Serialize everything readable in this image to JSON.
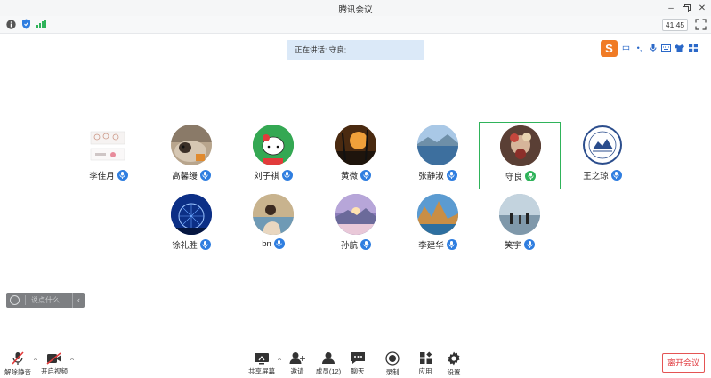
{
  "window": {
    "title": "腾讯会议"
  },
  "status": {
    "timer": "41:45"
  },
  "speaking_banner": "正在讲话: 守良;",
  "ime": {
    "logo": "S",
    "mode": "中",
    "punct": "•,"
  },
  "participants": [
    {
      "name": "李佳月",
      "mic": "on"
    },
    {
      "name": "高馨缦",
      "mic": "on"
    },
    {
      "name": "刘子祺",
      "mic": "on"
    },
    {
      "name": "黄微",
      "mic": "on"
    },
    {
      "name": "张静淑",
      "mic": "on"
    },
    {
      "name": "守良",
      "mic": "speaking",
      "active": true
    },
    {
      "name": "王之琼",
      "mic": "on"
    },
    {
      "name": "徐礼胜",
      "mic": "on"
    },
    {
      "name": "bn",
      "mic": "on"
    },
    {
      "name": "孙航",
      "mic": "on"
    },
    {
      "name": "李建华",
      "mic": "on"
    },
    {
      "name": "笑宇",
      "mic": "on"
    }
  ],
  "chat": {
    "placeholder": "说点什么..."
  },
  "toolbar": {
    "unmute": "解除静音",
    "start_video": "开启视频",
    "share_screen": "共享屏幕",
    "invite": "邀请",
    "members": "成员(12)",
    "chat": "聊天",
    "record": "录制",
    "apps": "应用",
    "settings": "设置",
    "leave": "离开会议"
  },
  "colors": {
    "accent": "#2f7ee0",
    "speaking": "#2fb35a",
    "leave": "#e0393e"
  }
}
